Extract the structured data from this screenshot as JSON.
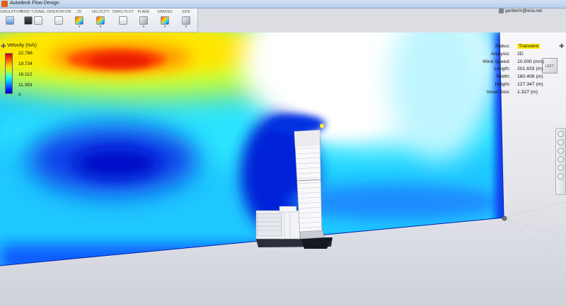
{
  "window": {
    "title": "Autodesk Flow Design"
  },
  "toolbar": {
    "groups": [
      {
        "label": "SIMULATION",
        "icon": "simulation-icon"
      },
      {
        "label": "WIND TUNNEL",
        "icon": "wind-tunnel-icon"
      },
      {
        "label": "ORIENTATION",
        "icon": "orientation-icon"
      },
      {
        "label": "2D",
        "icon": "2d-icon"
      },
      {
        "label": "VELOCITY",
        "icon": "velocity-icon"
      },
      {
        "label": "DRAG PLOT",
        "icon": "drag-plot-icon"
      },
      {
        "label": "PLANE",
        "icon": "plane-icon"
      },
      {
        "label": "SHADED",
        "icon": "shaded-icon"
      },
      {
        "label": "SIDE",
        "icon": "side-icon"
      }
    ]
  },
  "user": {
    "name": "gerberm@wra.net"
  },
  "viewcube": {
    "label": "LEFT"
  },
  "legend": {
    "title": "Velocity (m/s)",
    "ticks": [
      "22.786",
      "19.734",
      "16.112",
      "11.393",
      "0"
    ]
  },
  "info": {
    "rows": [
      {
        "label": "Status:",
        "value": "Transient"
      },
      {
        "label": "Analysis:",
        "value": "2D"
      },
      {
        "label": "Wind Speed:",
        "value": "10.000 (m/s)"
      },
      {
        "label": "Length:",
        "value": "201.633 (m)"
      },
      {
        "label": "Width:",
        "value": "180.408 (m)"
      },
      {
        "label": "Height:",
        "value": "127.347 (m)"
      },
      {
        "label": "Voxel Size:",
        "value": "1.327 (m)"
      }
    ]
  },
  "colors": {
    "accent": "#ffe800",
    "max": "#c8001a",
    "min": "#0000b4"
  }
}
